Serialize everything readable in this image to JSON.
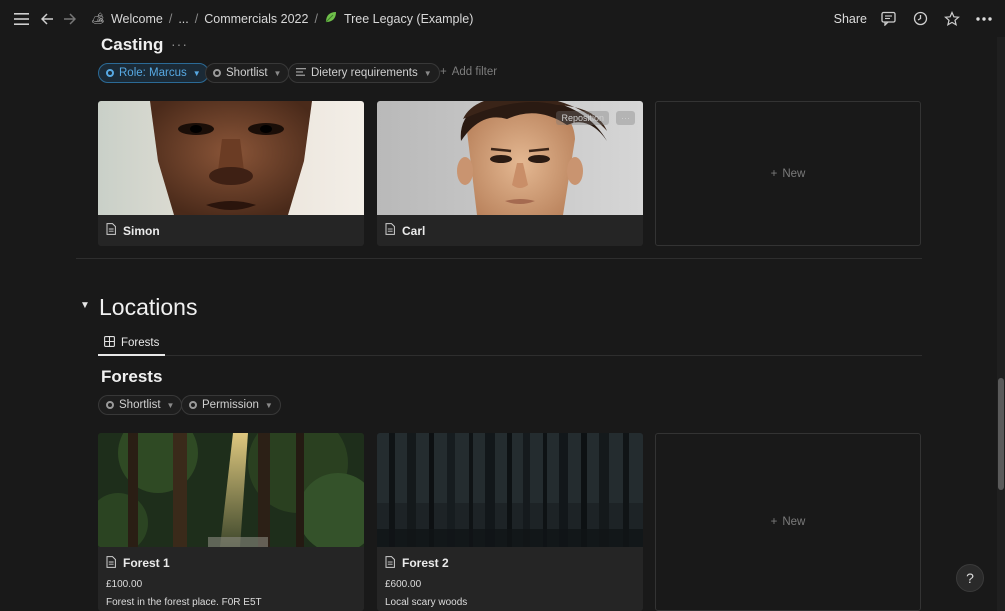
{
  "topbar": {
    "crumbs": [
      "Welcome",
      "...",
      "Commercials 2022",
      "Tree Legacy (Example)"
    ],
    "share": "Share"
  },
  "casting": {
    "title": "Casting",
    "more": "···",
    "filters": [
      "Role: Marcus",
      "Shortlist",
      "Dietery requirements"
    ],
    "add_filter": "Add filter",
    "cards": [
      {
        "title": "Simon"
      },
      {
        "title": "Carl",
        "reposition": "Reposition",
        "more": "···"
      }
    ],
    "new_label": "New"
  },
  "locations": {
    "title": "Locations",
    "tab": "Forests",
    "view_title": "Forests",
    "filters": [
      "Shortlist",
      "Permission"
    ],
    "cards": [
      {
        "title": "Forest 1",
        "price": "£100.00",
        "desc": "Forest in the forest place. F0R E5T"
      },
      {
        "title": "Forest 2",
        "price": "£600.00",
        "desc": "Local scary woods"
      }
    ],
    "new_label": "New"
  },
  "help": "?"
}
